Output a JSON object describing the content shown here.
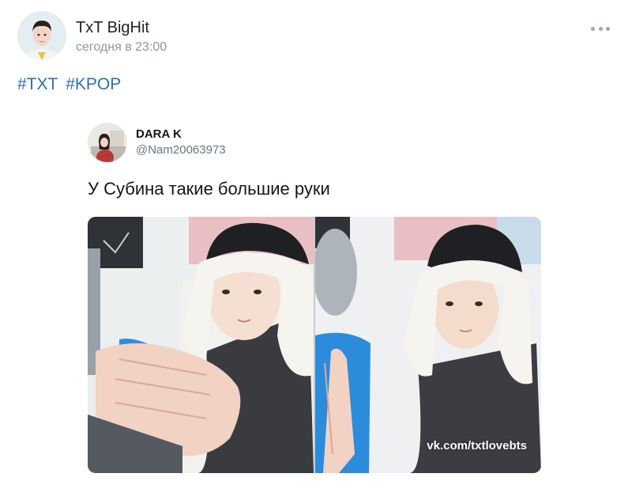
{
  "post": {
    "author": "TxT BigHit",
    "time": "сегодня в 23:00",
    "hashtags": [
      "#TXT",
      "#KPOP"
    ]
  },
  "tweet": {
    "name": "DARA K",
    "handle": "@Nam20063973",
    "text": "У Субина такие большие руки",
    "watermark": "vk.com/txtlovebts"
  },
  "icons": {
    "more": "more-horizontal-icon"
  }
}
